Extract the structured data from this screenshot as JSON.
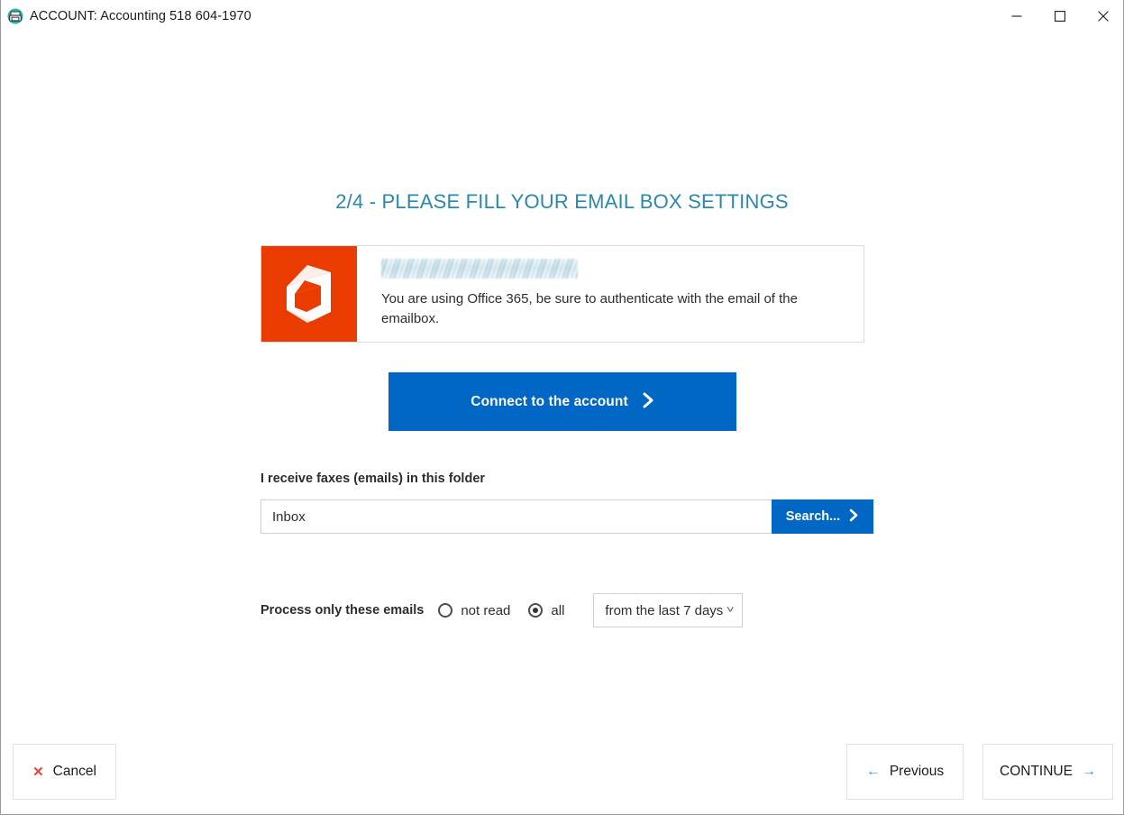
{
  "window": {
    "title": "ACCOUNT: Accounting 518 604-1970",
    "icon": "fax-account-icon",
    "controls": {
      "minimize": "minimize-icon",
      "maximize": "maximize-icon",
      "close": "close-icon"
    }
  },
  "page": {
    "title": "2/4 - PLEASE FILL YOUR EMAIL BOX SETTINGS",
    "title_color": "#2a88ab"
  },
  "notice": {
    "logo": "office-365-logo",
    "logo_color": "#eb3c00",
    "redacted_label": "",
    "message": "You are using Office 365, be sure to authenticate with the email of the emailbox."
  },
  "connect": {
    "label": "Connect to the account",
    "chevron": "chevron-right-icon",
    "color": "#0067c5"
  },
  "folder": {
    "label": "I receive faxes (emails) in this folder",
    "value": "Inbox",
    "placeholder": "Inbox",
    "search_label": "Search...",
    "search_chevron": "chevron-right-icon",
    "search_color": "#0067c5"
  },
  "process": {
    "label": "Process only these emails",
    "options": [
      {
        "label": "not read",
        "selected": false
      },
      {
        "label": "all",
        "selected": true
      }
    ],
    "period": {
      "selected": "from the last 7 days",
      "chevron": "chevron-down-icon"
    }
  },
  "footer": {
    "cancel": {
      "label": "Cancel",
      "icon": "x-icon",
      "icon_color": "#e8443a"
    },
    "previous": {
      "label": "Previous",
      "icon": "arrow-left-icon",
      "icon_color": "#2a9ed4"
    },
    "continue": {
      "label": "CONTINUE",
      "icon": "arrow-right-icon",
      "icon_color": "#2a9ed4"
    }
  }
}
